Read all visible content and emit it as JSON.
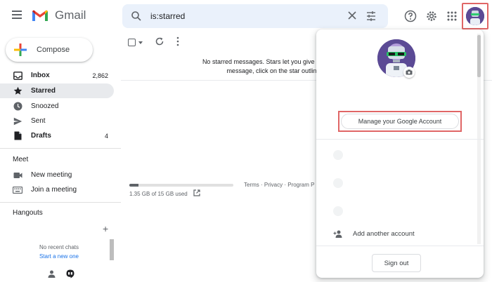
{
  "header": {
    "brand": "Gmail",
    "search_value": "is:starred"
  },
  "sidebar": {
    "compose_label": "Compose",
    "items": [
      {
        "label": "Inbox",
        "count": "2,862",
        "icon": "inbox-icon"
      },
      {
        "label": "Starred",
        "count": "",
        "icon": "star-icon"
      },
      {
        "label": "Snoozed",
        "count": "",
        "icon": "clock-icon"
      },
      {
        "label": "Sent",
        "count": "",
        "icon": "send-icon"
      },
      {
        "label": "Drafts",
        "count": "4",
        "icon": "draft-icon"
      }
    ],
    "meet": {
      "title": "Meet",
      "new_meeting": "New meeting",
      "join_meeting": "Join a meeting"
    },
    "hangouts": {
      "title": "Hangouts",
      "no_chats": "No recent chats",
      "start_new": "Start a new one"
    }
  },
  "main": {
    "empty_line1": "No starred messages. Stars let you give messages a special s",
    "empty_line2": "message, click on the star outline beside any",
    "storage_text": "1.35 GB of 15 GB used",
    "storage_fraction": 0.09,
    "footer": {
      "terms": "Terms",
      "sep1": " · ",
      "privacy": "Privacy",
      "sep2": " · ",
      "program": "Program P"
    }
  },
  "account_popover": {
    "manage_label": "Manage your Google Account",
    "add_account_label": "Add another account",
    "signout_label": "Sign out"
  },
  "colors": {
    "accent_blue": "#1a73e8",
    "highlight_red": "#e06666",
    "search_bg": "#eaf1fb",
    "active_nav_bg": "#e8eaed"
  }
}
